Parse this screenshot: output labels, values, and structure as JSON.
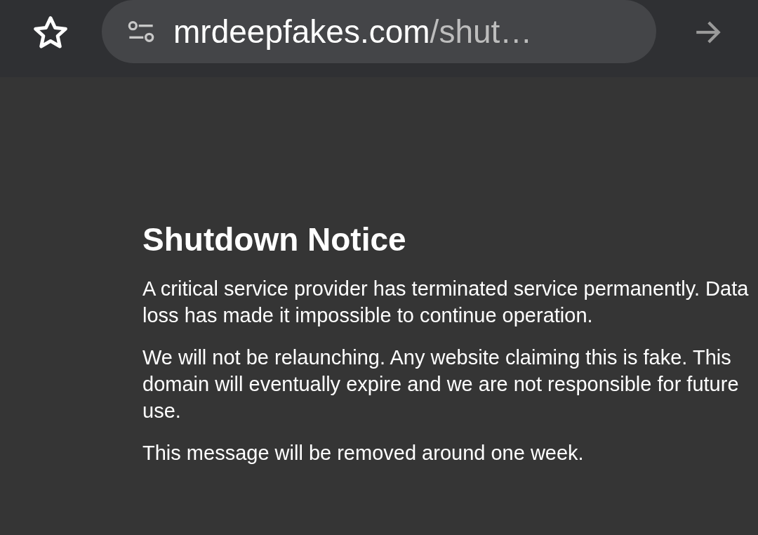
{
  "address_bar": {
    "host": "mrdeepfakes.com",
    "path": "/shut…"
  },
  "notice": {
    "title": "Shutdown Notice",
    "paragraphs": [
      "A critical service provider has terminated service permanently. Data loss has made it impossible to continue operation.",
      "We will not be relaunching. Any website claiming this is fake. This domain will eventually expire and we are not responsible for future use.",
      "This message will be removed around one week."
    ]
  }
}
